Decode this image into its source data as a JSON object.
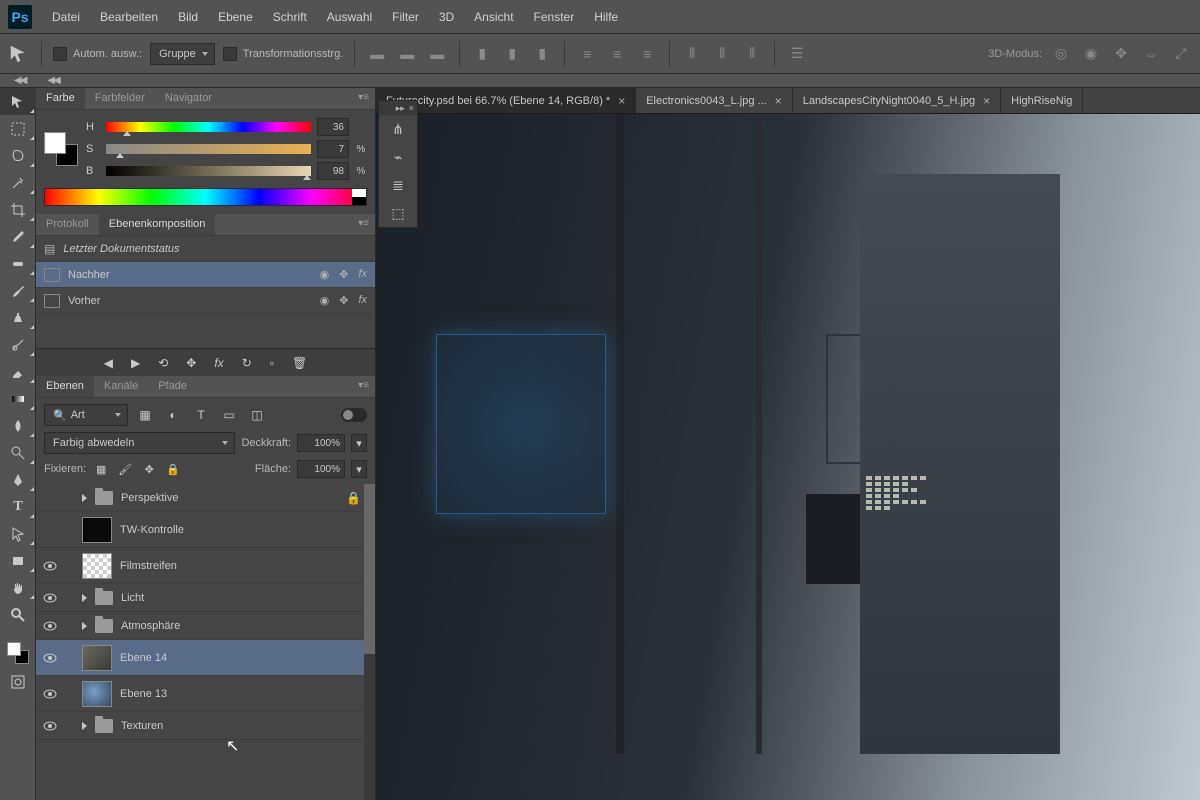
{
  "menu": [
    "Datei",
    "Bearbeiten",
    "Bild",
    "Ebene",
    "Schrift",
    "Auswahl",
    "Filter",
    "3D",
    "Ansicht",
    "Fenster",
    "Hilfe"
  ],
  "optbar": {
    "auto_select_label": "Autom. ausw.:",
    "auto_select_value": "Gruppe",
    "transform_label": "Transformationsstrg.",
    "mode3d_label": "3D-Modus:"
  },
  "document_tabs": [
    {
      "title": "Futurecity.psd bei 66.7% (Ebene 14, RGB/8) *",
      "active": true,
      "closeable": true
    },
    {
      "title": "Electronics0043_L.jpg ...",
      "active": false,
      "closeable": true
    },
    {
      "title": "LandscapesCityNight0040_5_H.jpg",
      "active": false,
      "closeable": true
    },
    {
      "title": "HighRiseNig",
      "active": false,
      "closeable": false
    }
  ],
  "color_panel": {
    "tabs": [
      "Farbe",
      "Farbfelder",
      "Navigator"
    ],
    "active_tab": "Farbe",
    "h": {
      "label": "H",
      "value": "36",
      "unit": ""
    },
    "s": {
      "label": "S",
      "value": "7",
      "unit": "%"
    },
    "b": {
      "label": "B",
      "value": "98",
      "unit": "%"
    }
  },
  "history_panel": {
    "tabs": [
      "Protokoll",
      "Ebenenkomposition"
    ],
    "active_tab": "Ebenenkomposition",
    "doc_status": "Letzter Dokumentstatus",
    "items": [
      {
        "name": "Nachher",
        "selected": true
      },
      {
        "name": "Vorher",
        "selected": false
      }
    ]
  },
  "layers_panel": {
    "tabs": [
      "Ebenen",
      "Kanäle",
      "Pfade"
    ],
    "active_tab": "Ebenen",
    "filter_dropdown": "Art",
    "blend_mode": "Farbig abwedeln",
    "opacity_label": "Deckkraft:",
    "opacity_value": "100%",
    "lock_label": "Fixieren:",
    "fill_label": "Fläche:",
    "fill_value": "100%",
    "layers": [
      {
        "name": "Perspektive",
        "type": "group",
        "visible": false,
        "locked": true
      },
      {
        "name": "TW-Kontrolle",
        "type": "layer",
        "thumb": "dark",
        "visible": false
      },
      {
        "name": "Filmstreifen",
        "type": "layer",
        "thumb": "checker",
        "visible": true
      },
      {
        "name": "Licht",
        "type": "group",
        "visible": true
      },
      {
        "name": "Atmosphäre",
        "type": "group",
        "visible": true
      },
      {
        "name": "Ebene 14",
        "type": "layer",
        "thumb": "t14",
        "visible": true,
        "selected": true
      },
      {
        "name": "Ebene 13",
        "type": "layer",
        "thumb": "t13",
        "visible": true
      },
      {
        "name": "Texturen",
        "type": "group",
        "visible": true
      }
    ]
  },
  "tools": [
    {
      "name": "move-tool",
      "active": true,
      "fly": true
    },
    {
      "name": "marquee-tool",
      "fly": true
    },
    {
      "name": "lasso-tool",
      "fly": true
    },
    {
      "name": "magic-wand-tool",
      "fly": true
    },
    {
      "name": "crop-tool",
      "fly": true
    },
    {
      "name": "eyedropper-tool",
      "fly": true
    },
    {
      "name": "healing-brush-tool",
      "fly": true
    },
    {
      "name": "brush-tool",
      "fly": true
    },
    {
      "name": "clone-stamp-tool",
      "fly": true
    },
    {
      "name": "history-brush-tool",
      "fly": true
    },
    {
      "name": "eraser-tool",
      "fly": true
    },
    {
      "name": "gradient-tool",
      "fly": true
    },
    {
      "name": "blur-tool",
      "fly": true
    },
    {
      "name": "dodge-tool",
      "fly": true
    },
    {
      "name": "pen-tool",
      "fly": true
    },
    {
      "name": "type-tool",
      "fly": true
    },
    {
      "name": "path-select-tool",
      "fly": true
    },
    {
      "name": "rectangle-tool",
      "fly": true
    },
    {
      "name": "hand-tool",
      "fly": true
    },
    {
      "name": "zoom-tool",
      "fly": false
    }
  ]
}
